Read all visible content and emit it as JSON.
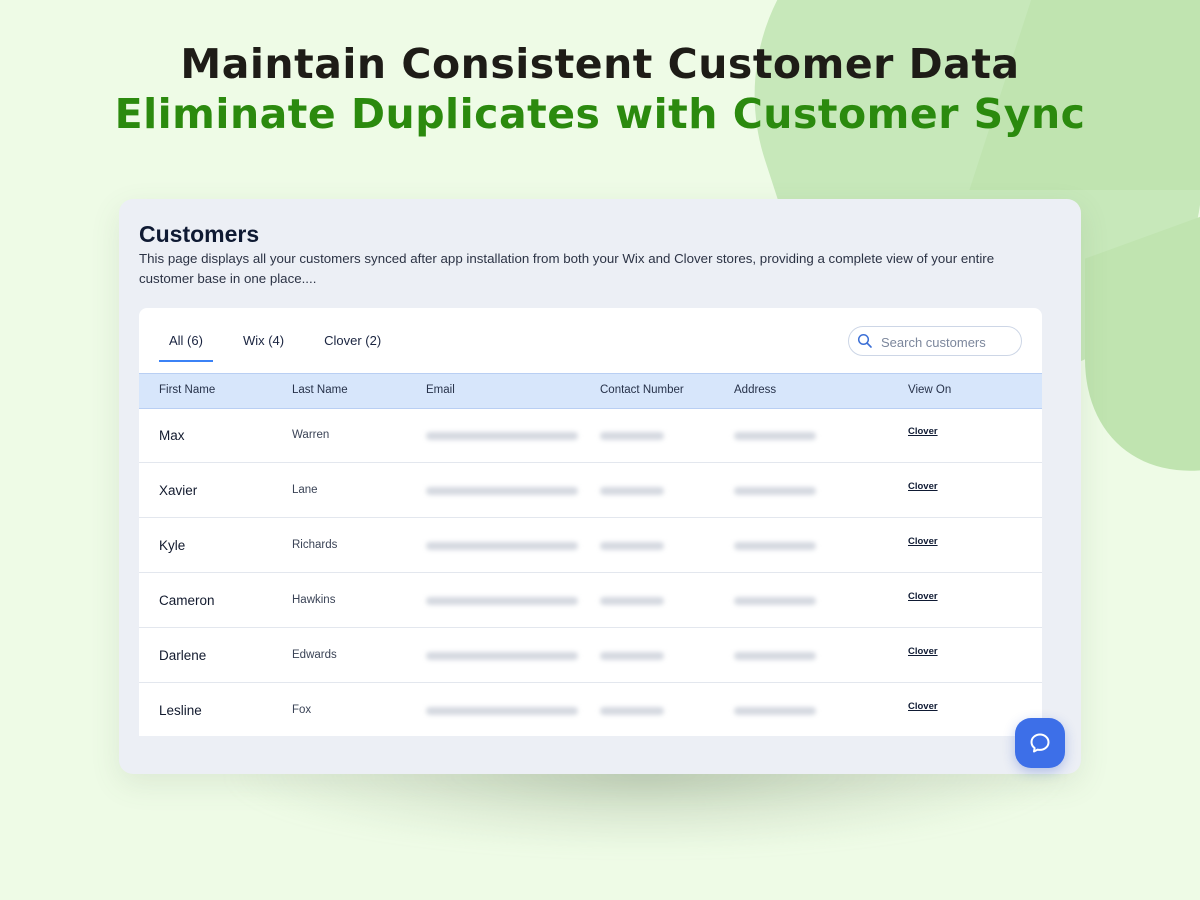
{
  "headline": {
    "line1": "Maintain Consistent Customer Data",
    "line2": "Eliminate Duplicates with Customer Sync"
  },
  "panel": {
    "title": "Customers",
    "description": "This page displays all your customers synced after app installation from both your Wix and Clover stores, providing a complete view of your entire customer base in one place...."
  },
  "tabs": [
    {
      "label": "All (6)",
      "active": true
    },
    {
      "label": "Wix (4)",
      "active": false
    },
    {
      "label": "Clover (2)",
      "active": false
    }
  ],
  "search": {
    "placeholder": "Search customers",
    "value": ""
  },
  "table": {
    "columns": [
      "First Name",
      "Last Name",
      "Email",
      "Contact Number",
      "Address",
      "View On"
    ],
    "rows": [
      {
        "first": "Max",
        "last": "Warren",
        "view": "Clover"
      },
      {
        "first": "Xavier",
        "last": "Lane",
        "view": "Clover"
      },
      {
        "first": "Kyle",
        "last": "Richards",
        "view": "Clover"
      },
      {
        "first": "Cameron",
        "last": "Hawkins",
        "view": "Clover"
      },
      {
        "first": "Darlene",
        "last": "Edwards",
        "view": "Clover"
      },
      {
        "first": "Lesline",
        "last": "Fox",
        "view": "Clover"
      }
    ]
  },
  "icons": {
    "search": "search-icon",
    "chat": "chat-bubble-icon"
  },
  "colors": {
    "accent": "#3d6fe8",
    "headline_green": "#2b8a0e",
    "tab_underline": "#3b82f6"
  }
}
